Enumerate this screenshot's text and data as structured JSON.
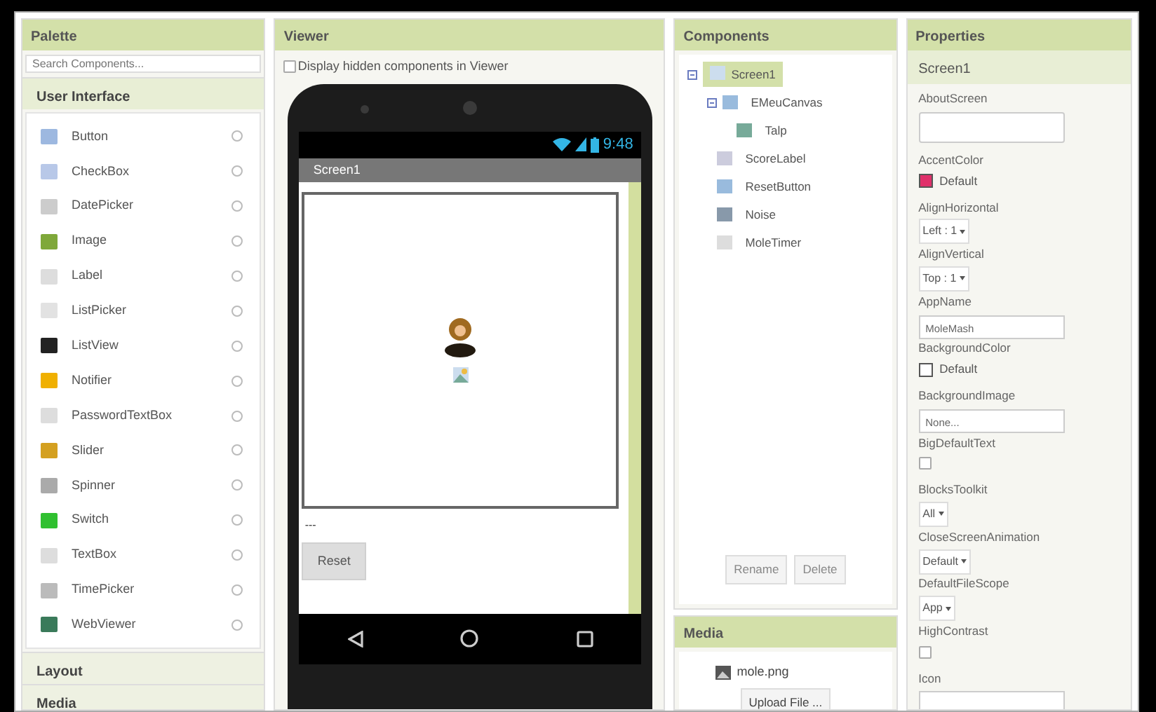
{
  "palette": {
    "title": "Palette",
    "search_placeholder": "Search Components...",
    "sections": [
      {
        "title": "User Interface",
        "expanded": true,
        "items": [
          "Button",
          "CheckBox",
          "DatePicker",
          "Image",
          "Label",
          "ListPicker",
          "ListView",
          "Notifier",
          "PasswordTextBox",
          "Slider",
          "Spinner",
          "Switch",
          "TextBox",
          "TimePicker",
          "WebViewer"
        ]
      },
      {
        "title": "Layout",
        "expanded": false
      },
      {
        "title": "Media",
        "expanded": false
      }
    ]
  },
  "viewer": {
    "title": "Viewer",
    "hidden_checkbox": {
      "label": "Display hidden components in Viewer",
      "checked": false
    },
    "phone": {
      "time": "9:48",
      "screen_title": "Screen1",
      "score_label": "---",
      "reset_button": "Reset"
    }
  },
  "components": {
    "title": "Components",
    "tree": [
      {
        "label": "Screen1",
        "selected": true,
        "expanded": true,
        "children": [
          {
            "label": "EMeuCanvas",
            "selected": false,
            "expanded": true,
            "children": [
              {
                "label": "Talp",
                "selected": false
              }
            ]
          },
          {
            "label": "ScoreLabel",
            "selected": false
          },
          {
            "label": "ResetButton",
            "selected": false
          },
          {
            "label": "Noise",
            "selected": false
          },
          {
            "label": "MoleTimer",
            "selected": false
          }
        ]
      }
    ],
    "buttons": [
      "Rename",
      "Delete"
    ]
  },
  "media": {
    "title": "Media",
    "files": [
      "mole.png"
    ],
    "upload_button": "Upload File ..."
  },
  "properties": {
    "title": "Properties",
    "component": "Screen1",
    "items": [
      {
        "label": "AboutScreen",
        "kind": "textarea"
      },
      {
        "label": "AccentColor",
        "kind": "color",
        "value": "Default",
        "color": "#e0306a"
      },
      {
        "label": "AlignHorizontal",
        "kind": "select",
        "value": "Left : 1"
      },
      {
        "label": "AlignVertical",
        "kind": "select",
        "value": "Top : 1"
      },
      {
        "label": "AppName",
        "kind": "text",
        "value": "MoleMash"
      },
      {
        "label": "BackgroundColor",
        "kind": "color",
        "value": "Default",
        "color": "#ffffff"
      },
      {
        "label": "BackgroundImage",
        "kind": "text",
        "value": "None..."
      },
      {
        "label": "BigDefaultText",
        "kind": "checkbox",
        "checked": false
      },
      {
        "label": "BlocksToolkit",
        "kind": "select",
        "value": "All"
      },
      {
        "label": "CloseScreenAnimation",
        "kind": "select",
        "value": "Default"
      },
      {
        "label": "DefaultFileScope",
        "kind": "select",
        "value": "App"
      },
      {
        "label": "HighContrast",
        "kind": "checkbox",
        "checked": false
      },
      {
        "label": "Icon",
        "kind": "text"
      }
    ]
  }
}
